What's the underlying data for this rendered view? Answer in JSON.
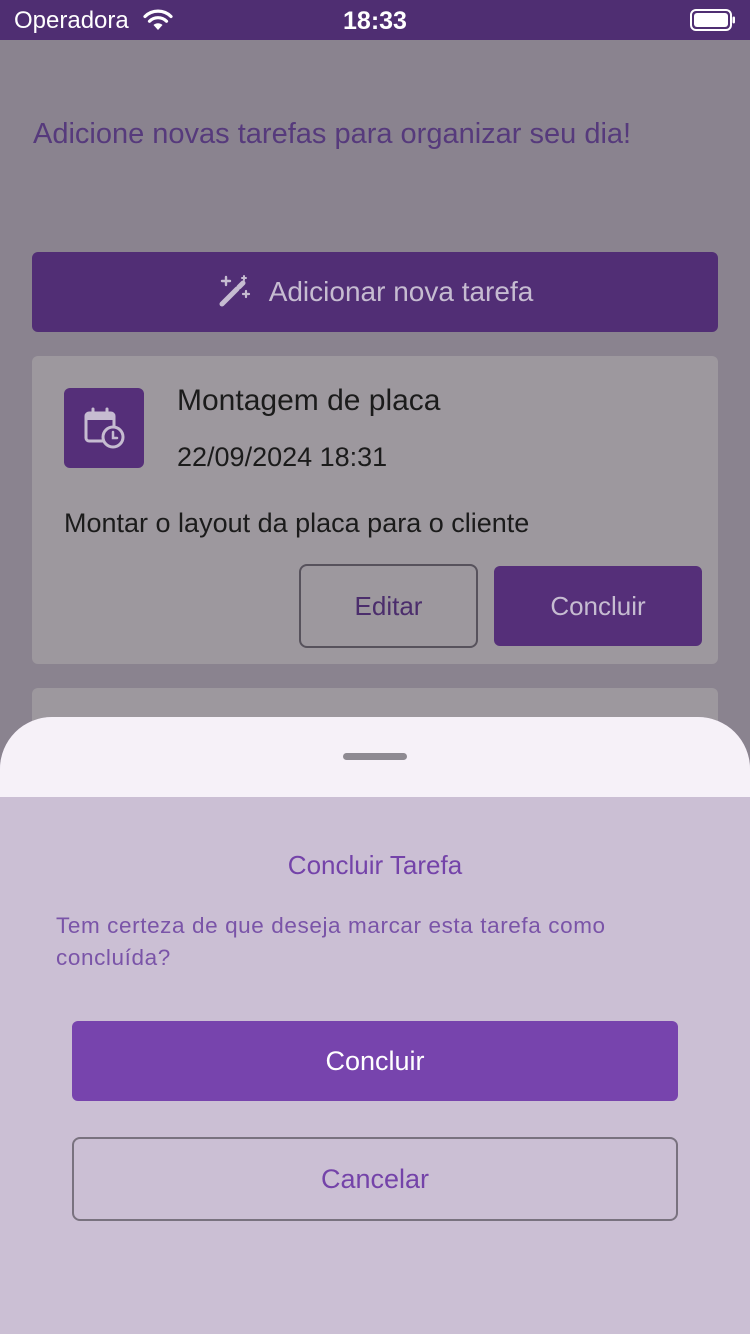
{
  "status_bar": {
    "carrier": "Operadora",
    "time": "18:33",
    "wifi_icon": "wifi-icon",
    "battery_icon": "battery-icon"
  },
  "main": {
    "intro": "Adicione novas tarefas para organizar seu dia!",
    "add_button": {
      "label": "Adicionar nova tarefa",
      "icon": "magic-wand-icon"
    },
    "tasks": [
      {
        "title": "Montagem de placa",
        "datetime": "22/09/2024 18:31",
        "description": "Montar o layout da placa para o cliente",
        "icon": "calendar-clock-icon",
        "edit_label": "Editar",
        "complete_label": "Concluir"
      }
    ]
  },
  "dialog": {
    "title": "Concluir Tarefa",
    "message": "Tem certeza de que deseja marcar esta tarefa como concluída?",
    "confirm_label": "Concluir",
    "cancel_label": "Cancelar"
  },
  "colors": {
    "primary": "#7744ad",
    "primary_dimmed": "#512e75",
    "sheet_background": "#cbbfd4",
    "overlay_background": "#8a838f"
  }
}
